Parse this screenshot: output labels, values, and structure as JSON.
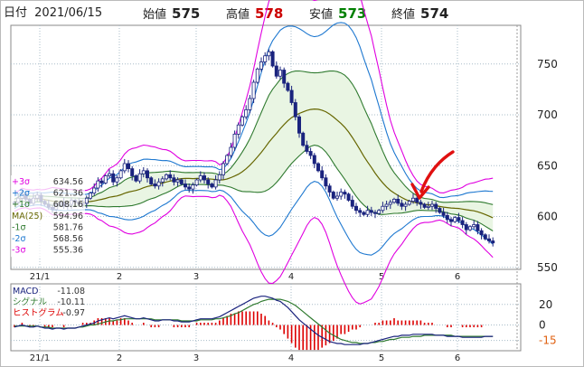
{
  "header": {
    "date_label": "日付",
    "date_value": "2021/06/15",
    "open_label": "始値",
    "open_value": "575",
    "high_label": "高値",
    "high_value": "578",
    "low_label": "安値",
    "low_value": "573",
    "close_label": "終値",
    "close_value": "574"
  },
  "colors": {
    "high": "#cc0000",
    "low": "#008000",
    "candle": "#1a237e",
    "ma": "#666600",
    "band1": "#2f7a2f",
    "band2": "#1e78d0",
    "band3": "#e000e0",
    "macd": "#1a237e",
    "signal": "#2f7a2f",
    "histogram": "#dd0000",
    "arrow": "#e01010",
    "grid": "#a8bcc8"
  },
  "chart_data": [
    {
      "type": "candlestick",
      "x_ticks": [
        "21/1",
        "2",
        "3",
        "4",
        "5",
        "6"
      ],
      "ylim": [
        548,
        788
      ],
      "y_ticks": [
        550,
        600,
        650,
        700,
        750
      ],
      "grid": true,
      "legend": [
        {
          "label": "+3σ",
          "value": "634.56",
          "color": "#e000e0"
        },
        {
          "label": "+2σ",
          "value": "621.36",
          "color": "#1e78d0"
        },
        {
          "label": "+1σ",
          "value": "608.16",
          "color": "#2f7a2f"
        },
        {
          "label": "MA(25)",
          "value": "594.96",
          "color": "#666600"
        },
        {
          "label": "-1σ",
          "value": "581.76",
          "color": "#2f7a2f"
        },
        {
          "label": "-2σ",
          "value": "568.56",
          "color": "#1e78d0"
        },
        {
          "label": "-3σ",
          "value": "555.36",
          "color": "#e000e0"
        }
      ],
      "close": [
        614,
        618,
        622,
        617,
        613,
        618,
        621,
        615,
        612,
        609,
        607,
        611,
        614,
        610,
        612,
        616,
        614,
        612,
        613,
        618,
        623,
        628,
        635,
        633,
        640,
        642,
        634,
        638,
        645,
        652,
        647,
        640,
        635,
        642,
        645,
        638,
        632,
        630,
        634,
        637,
        641,
        638,
        634,
        636,
        632,
        629,
        627,
        631,
        636,
        640,
        636,
        632,
        629,
        636,
        641,
        652,
        660,
        668,
        681,
        690,
        698,
        705,
        716,
        732,
        745,
        752,
        758,
        762,
        748,
        738,
        744,
        731,
        724,
        712,
        698,
        682,
        670,
        664,
        660,
        652,
        645,
        638,
        630,
        624,
        618,
        620,
        624,
        622,
        616,
        610,
        606,
        604,
        602,
        606,
        604,
        603,
        606,
        610,
        612,
        614,
        617,
        613,
        610,
        612,
        615,
        618,
        614,
        612,
        609,
        610,
        612,
        608,
        604,
        601,
        597,
        595,
        599,
        596,
        592,
        587,
        590,
        592,
        586,
        582,
        578,
        576,
        574
      ],
      "ohlc_current": {
        "open": 575,
        "high": 578,
        "low": 573,
        "close": 574
      },
      "annotation": "red arrow pointing down at the touch of the MA(25) line"
    },
    {
      "type": "line",
      "x_ticks": [
        "21/1",
        "2",
        "3",
        "4",
        "5",
        "6"
      ],
      "ylim": [
        -25,
        40
      ],
      "y_ticks": [
        20,
        0,
        -15
      ],
      "series": [
        {
          "name": "MACD",
          "value": "-11.08"
        },
        {
          "name": "シグナル",
          "value": "-10.11"
        },
        {
          "name": "ヒストグラム",
          "value": "-0.97"
        }
      ],
      "macd": [
        -2,
        -1,
        0,
        -1,
        -2,
        -2,
        -1,
        -2,
        -3,
        -3,
        -4,
        -3,
        -3,
        -4,
        -3,
        -3,
        -3,
        -2,
        -1,
        0,
        1,
        2,
        4,
        5,
        6,
        7,
        6,
        7,
        8,
        9,
        8,
        7,
        6,
        6,
        7,
        6,
        5,
        4,
        4,
        5,
        5,
        5,
        4,
        4,
        3,
        3,
        3,
        4,
        5,
        6,
        6,
        6,
        6,
        7,
        8,
        10,
        12,
        14,
        16,
        18,
        20,
        22,
        24,
        26,
        27,
        28,
        28,
        27,
        26,
        24,
        23,
        20,
        17,
        13,
        9,
        5,
        2,
        -1,
        -4,
        -7,
        -10,
        -12,
        -14,
        -16,
        -17,
        -18,
        -18,
        -19,
        -19,
        -19,
        -19,
        -19,
        -18,
        -18,
        -17,
        -16,
        -15,
        -14,
        -13,
        -12,
        -11,
        -11,
        -10,
        -10,
        -10,
        -9,
        -9,
        -9,
        -9,
        -9,
        -9,
        -10,
        -10,
        -10,
        -11,
        -11,
        -11,
        -11,
        -12,
        -12,
        -12,
        -12,
        -12,
        -12,
        -11,
        -11,
        -11
      ],
      "signal": [
        -1,
        -1,
        -1,
        -1,
        -1,
        -1,
        -1,
        -2,
        -2,
        -2,
        -3,
        -3,
        -3,
        -3,
        -3,
        -3,
        -3,
        -2,
        -2,
        -1,
        0,
        0,
        1,
        2,
        3,
        4,
        4,
        5,
        5,
        6,
        6,
        6,
        6,
        6,
        6,
        6,
        6,
        5,
        5,
        5,
        5,
        5,
        5,
        5,
        4,
        4,
        4,
        4,
        4,
        5,
        5,
        5,
        5,
        6,
        6,
        7,
        8,
        9,
        11,
        12,
        14,
        16,
        18,
        20,
        21,
        23,
        24,
        25,
        25,
        25,
        25,
        24,
        23,
        21,
        19,
        16,
        13,
        10,
        7,
        4,
        1,
        -2,
        -5,
        -8,
        -10,
        -12,
        -14,
        -15,
        -16,
        -17,
        -17,
        -18,
        -18,
        -18,
        -17,
        -17,
        -16,
        -16,
        -15,
        -14,
        -14,
        -13,
        -12,
        -12,
        -12,
        -11,
        -11,
        -11,
        -10,
        -10,
        -10,
        -10,
        -10,
        -10,
        -10,
        -10,
        -11,
        -11,
        -11,
        -11,
        -11,
        -11,
        -11,
        -11,
        -11,
        -11,
        -11
      ]
    }
  ]
}
